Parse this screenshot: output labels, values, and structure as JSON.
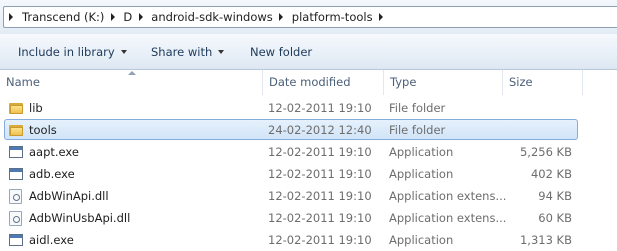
{
  "address_bar": {
    "crumbs": [
      "Transcend (K:)",
      "D",
      "android-sdk-windows",
      "platform-tools"
    ]
  },
  "command_bar": {
    "include_library": "Include in library",
    "share_with": "Share with",
    "new_folder": "New folder"
  },
  "columns": {
    "name": "Name",
    "date_modified": "Date modified",
    "type": "Type",
    "size": "Size"
  },
  "files": [
    {
      "icon": "folder-icon",
      "name": "lib",
      "date": "12-02-2011 19:10",
      "type": "File folder",
      "size": "",
      "selected": false
    },
    {
      "icon": "folder-icon",
      "name": "tools",
      "date": "24-02-2012 12:40",
      "type": "File folder",
      "size": "",
      "selected": true
    },
    {
      "icon": "application-icon",
      "name": "aapt.exe",
      "date": "12-02-2011 19:10",
      "type": "Application",
      "size": "5,256 KB",
      "selected": false
    },
    {
      "icon": "application-icon",
      "name": "adb.exe",
      "date": "12-02-2011 19:10",
      "type": "Application",
      "size": "402 KB",
      "selected": false
    },
    {
      "icon": "dll-icon",
      "name": "AdbWinApi.dll",
      "date": "12-02-2011 19:10",
      "type": "Application extens...",
      "size": "94 KB",
      "selected": false
    },
    {
      "icon": "dll-icon",
      "name": "AdbWinUsbApi.dll",
      "date": "12-02-2011 19:10",
      "type": "Application extens...",
      "size": "60 KB",
      "selected": false
    },
    {
      "icon": "application-icon",
      "name": "aidl.exe",
      "date": "12-02-2011 19:10",
      "type": "Application",
      "size": "1,313 KB",
      "selected": false
    }
  ]
}
